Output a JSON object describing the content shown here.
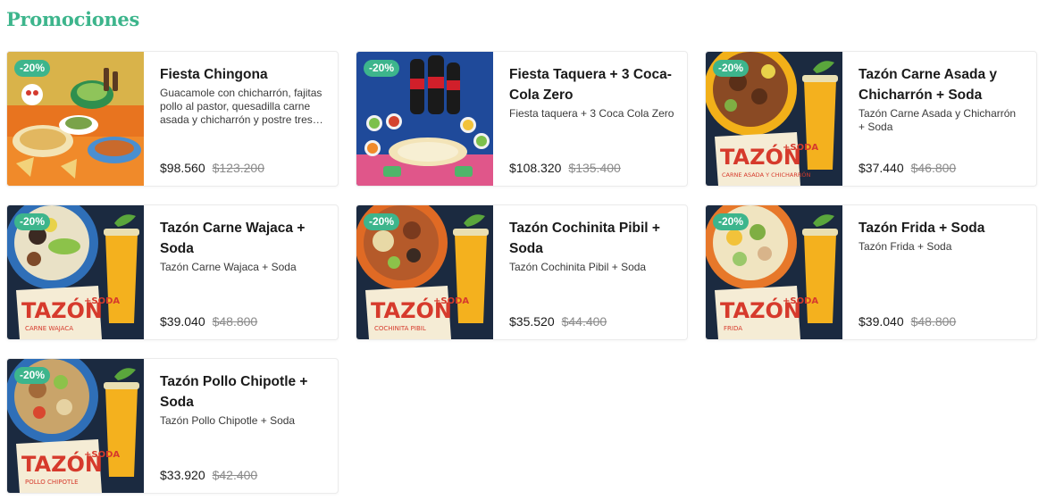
{
  "section": {
    "title": "Promociones"
  },
  "colors": {
    "accent": "#3db58c"
  },
  "products": [
    {
      "name": "Fiesta Chingona",
      "description": "Guacamole con chicharrón, fajitas pollo al pastor, quesadilla carne asada y chicharrón y postre tres leches",
      "price": "$98.560",
      "old_price": "$123.200",
      "discount": "-20%",
      "image_icon": "fiesta-food-spread-image"
    },
    {
      "name": "Fiesta Taquera + 3 Coca-Cola Zero",
      "description": "Fiesta taquera + 3 Coca Cola Zero",
      "price": "$108.320",
      "old_price": "$135.400",
      "discount": "-20%",
      "image_icon": "fiesta-taquera-cola-image"
    },
    {
      "name": "Tazón Carne Asada y Chicharrón + Soda",
      "description": "Tazón Carne Asada y Chicharrón + Soda",
      "price": "$37.440",
      "old_price": "$46.800",
      "discount": "-20%",
      "image_icon": "bowl-soda-image",
      "image_title": "TAZÓN",
      "image_subtitle": "+SODA",
      "image_caption": "CARNE ASADA Y CHICHARRÓN"
    },
    {
      "name": "Tazón Carne Wajaca + Soda",
      "description": "Tazón Carne Wajaca + Soda",
      "price": "$39.040",
      "old_price": "$48.800",
      "discount": "-20%",
      "image_icon": "bowl-soda-image",
      "image_title": "TAZÓN",
      "image_subtitle": "+SODA",
      "image_caption": "CARNE WAJACA"
    },
    {
      "name": "Tazón Cochinita Pibil + Soda",
      "description": "Tazón Cochinita Pibil + Soda",
      "price": "$35.520",
      "old_price": "$44.400",
      "discount": "-20%",
      "image_icon": "bowl-soda-image",
      "image_title": "TAZÓN",
      "image_subtitle": "+SODA",
      "image_caption": "COCHINITA PIBIL"
    },
    {
      "name": "Tazón Frida + Soda",
      "description": "Tazón Frida + Soda",
      "price": "$39.040",
      "old_price": "$48.800",
      "discount": "-20%",
      "image_icon": "bowl-soda-image",
      "image_title": "TAZÓN",
      "image_subtitle": "+SODA",
      "image_caption": "FRIDA"
    },
    {
      "name": "Tazón Pollo Chipotle + Soda",
      "description": "Tazón Pollo Chipotle + Soda",
      "price": "$33.920",
      "old_price": "$42.400",
      "discount": "-20%",
      "image_icon": "bowl-soda-image",
      "image_title": "TAZÓN",
      "image_subtitle": "+SODA",
      "image_caption": "POLLO CHIPOTLE"
    }
  ]
}
